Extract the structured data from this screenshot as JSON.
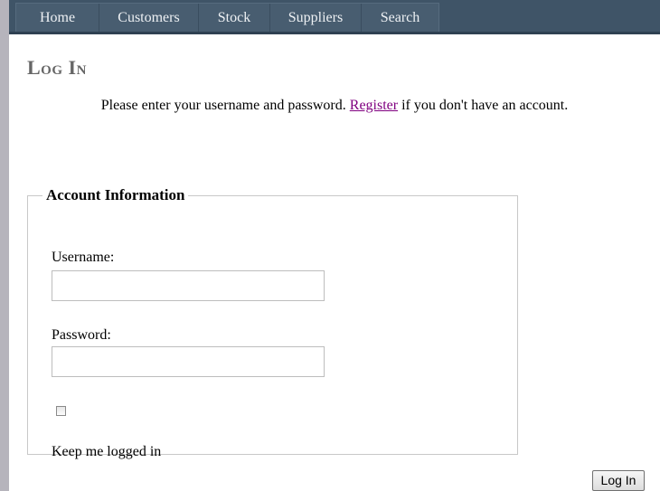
{
  "nav": {
    "items": [
      {
        "label": "Home"
      },
      {
        "label": "Customers"
      },
      {
        "label": "Stock"
      },
      {
        "label": "Suppliers"
      },
      {
        "label": "Search"
      }
    ]
  },
  "page": {
    "title": "Log In"
  },
  "intro": {
    "before_link": "Please enter your username and password. ",
    "link_label": "Register",
    "after_link": " if you don't have an account."
  },
  "form": {
    "legend": "Account Information",
    "username_label": "Username:",
    "username_value": "",
    "password_label": "Password:",
    "password_value": "",
    "remember_label": "Keep me logged in",
    "remember_checked": false,
    "submit_label": "Log In"
  },
  "colors": {
    "nav_background": "#3f5467",
    "title_text": "#666666",
    "link_visited": "#800080"
  }
}
